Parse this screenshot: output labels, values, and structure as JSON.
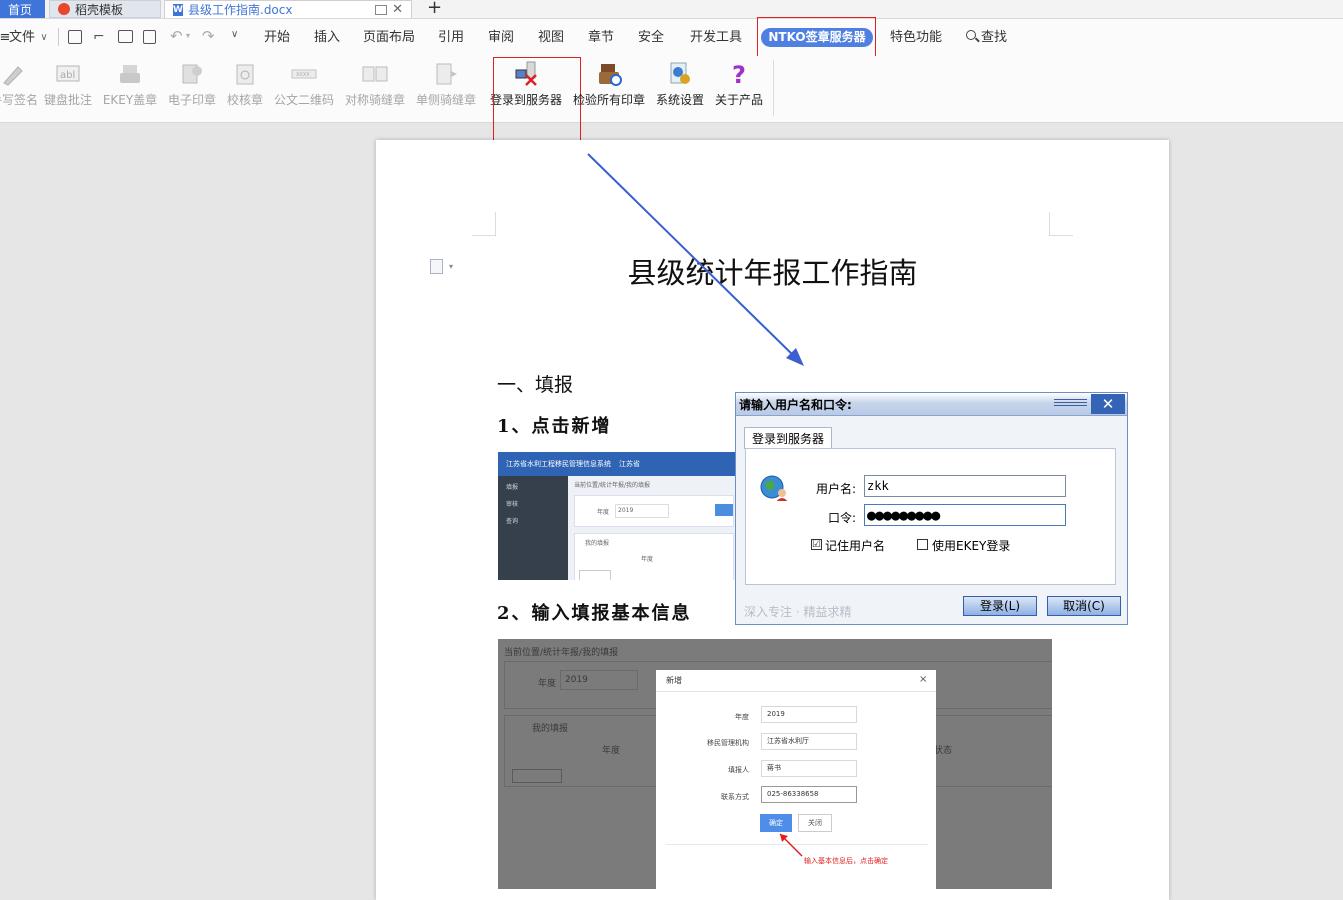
{
  "tabs": {
    "home_label": "首页",
    "template_label": "稻壳模板",
    "document_label": "县级工作指南.docx"
  },
  "menu": {
    "file_label": "文件",
    "items": [
      "开始",
      "插入",
      "页面布局",
      "引用",
      "审阅",
      "视图",
      "章节",
      "安全",
      "开发工具"
    ],
    "ntko_label": "NTKO签章服务器",
    "special_label": "特色功能",
    "search_label": "查找"
  },
  "ribbon": {
    "disabled_items": [
      "手写签名",
      "键盘批注",
      "EKEY盖章",
      "电子印章",
      "校核章",
      "公文二维码",
      "对称骑缝章",
      "单侧骑缝章"
    ],
    "login_label": "登录到服务器",
    "verify_label": "检验所有印章",
    "settings_label": "系统设置",
    "about_label": "关于产品"
  },
  "document": {
    "title": "县级统计年报工作指南",
    "section1": "一、填报",
    "step1": "1、点击新增",
    "step2": "2、输入填报基本信息"
  },
  "screenshot1": {
    "system_name": "江苏省水利工程移民管理信息系统",
    "region": "江苏省",
    "side_items": [
      "填报",
      "审核",
      "查询"
    ],
    "breadcrumb": "当前位置/统计年报/我的填报",
    "year_label": "年度",
    "year_value": "2019",
    "card_title": "我的填报",
    "col_year": "年度"
  },
  "screenshot2": {
    "breadcrumb": "当前位置/统计年报/我的填报",
    "year_label": "年度",
    "year_value": "2019",
    "card_title": "我的填报",
    "col_year": "年度",
    "col_status": "状态",
    "modal_title": "新增",
    "fields": [
      {
        "label": "年度",
        "value": "2019"
      },
      {
        "label": "移民管理机构",
        "value": "江苏省水利厅"
      },
      {
        "label": "填报人",
        "value": "蒋书"
      },
      {
        "label": "联系方式",
        "value": "025-86338658"
      }
    ],
    "ok_label": "确定",
    "close_label": "关闭",
    "note": "输入基本信息后，点击确定"
  },
  "login_dialog": {
    "title": "请输入用户名和口令:",
    "tab_label": "登录到服务器",
    "username_label": "用户名:",
    "username_value": "zkk",
    "password_label": "口令:",
    "password_value": "●●●●●●●●●",
    "remember_label": "记住用户名",
    "remember_checked": "☑",
    "ekey_label": "使用EKEY登录",
    "footer": "深入专注 · 精益求精",
    "login_button": "登录(L)",
    "cancel_button": "取消(C)"
  }
}
